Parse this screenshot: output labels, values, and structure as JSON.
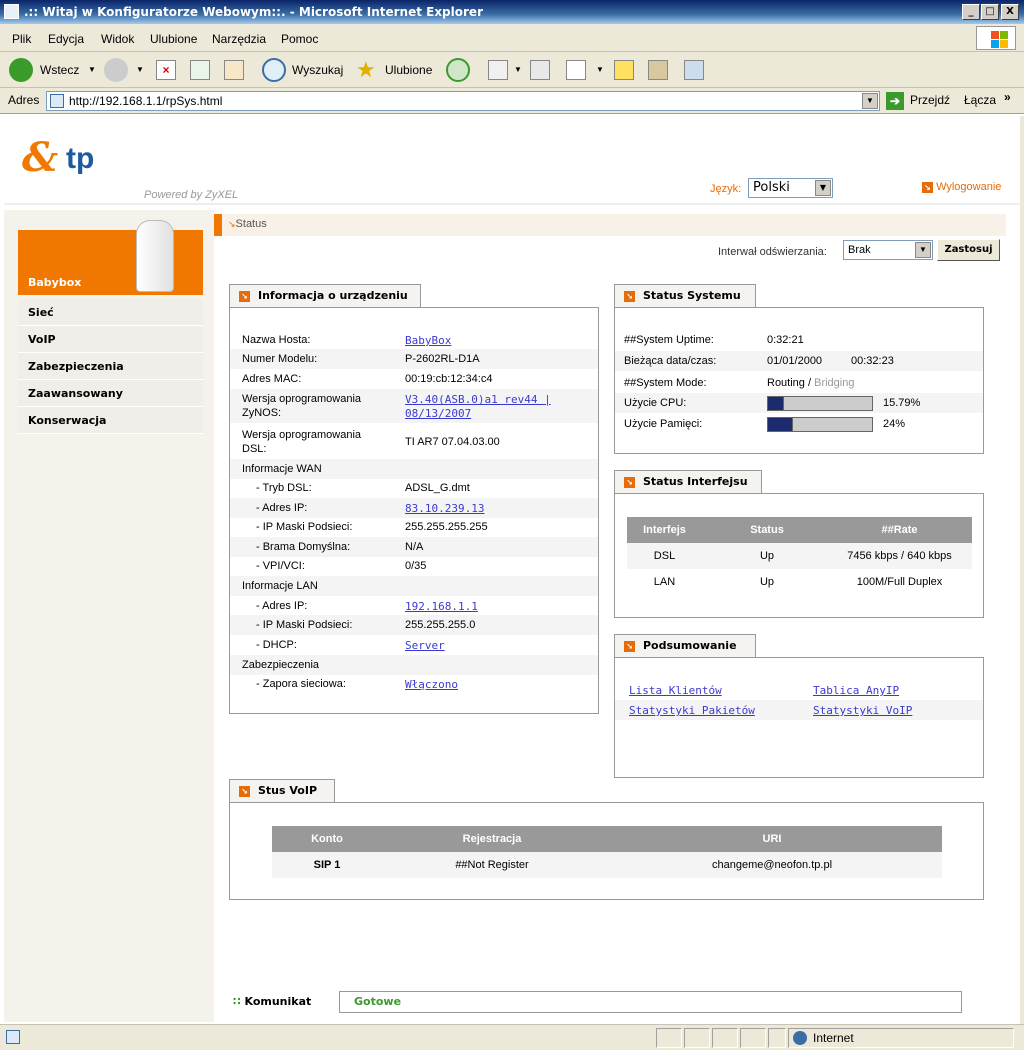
{
  "window": {
    "title": ".:: Witaj w Konfiguratorze Webowym::. - Microsoft Internet Explorer",
    "minimize": "_",
    "maximize": "□",
    "close": "X"
  },
  "menu": {
    "items": [
      "Plik",
      "Edycja",
      "Widok",
      "Ulubione",
      "Narzędzia",
      "Pomoc"
    ]
  },
  "toolbar": {
    "back": "Wstecz",
    "search": "Wyszukaj",
    "favorites": "Ulubione"
  },
  "address": {
    "label": "Adres",
    "url": "http://192.168.1.1/rpSys.html",
    "go": "Przejdź",
    "links": "Łącza",
    "more": "»"
  },
  "header": {
    "logo_amp": "&",
    "logo_tp": "tp",
    "powered": "Powered by ZyXEL",
    "language_label": "Język:",
    "language_value": "Polski",
    "logout": "Wylogowanie"
  },
  "sidebar": {
    "title": "Babybox",
    "items": [
      {
        "label": "Sieć"
      },
      {
        "label": "VoIP"
      },
      {
        "label": "Zabezpieczenia"
      },
      {
        "label": "Zaawansowany"
      },
      {
        "label": "Konserwacja"
      }
    ]
  },
  "breadcrumb": "Status",
  "refresh": {
    "label": "Interwał odświerzania:",
    "value": "Brak",
    "apply": "Zastosuj"
  },
  "device_info": {
    "title": "Informacja o urządzeniu",
    "host_label": "Nazwa Hosta:",
    "host_value": "BabyBox",
    "model_label": "Numer Modelu:",
    "model_value": "P-2602RL-D1A",
    "mac_label": "Adres MAC:",
    "mac_value": "00:19:cb:12:34:c4",
    "zynos_label1": "Wersja oprogramowania",
    "zynos_label2": "ZyNOS:",
    "zynos_value1": "V3.40(ASB.0)a1 rev44 |",
    "zynos_value2": "08/13/2007",
    "dsl_label1": "Wersja oprogramowania",
    "dsl_label2": "DSL:",
    "dsl_value": "TI AR7 07.04.03.00",
    "wan_header": "Informacje WAN",
    "wan_mode_label": "- Tryb DSL:",
    "wan_mode_value": "ADSL_G.dmt",
    "wan_ip_label": "- Adres IP:",
    "wan_ip_value": "83.10.239.13",
    "wan_mask_label": "- IP Maski Podsieci:",
    "wan_mask_value": "255.255.255.255",
    "wan_gw_label": "- Brama Domyślna:",
    "wan_gw_value": "N/A",
    "wan_vpi_label": "- VPI/VCI:",
    "wan_vpi_value": "0/35",
    "lan_header": "Informacje LAN",
    "lan_ip_label": "- Adres IP:",
    "lan_ip_value": "192.168.1.1",
    "lan_mask_label": "- IP Maski Podsieci:",
    "lan_mask_value": "255.255.255.0",
    "lan_dhcp_label": "- DHCP:",
    "lan_dhcp_value": "Server",
    "sec_header": "Zabezpieczenia",
    "fw_label": "- Zapora sieciowa:",
    "fw_value": "Włączono"
  },
  "system_status": {
    "title": "Status Systemu",
    "uptime_label": "##System Uptime:",
    "uptime_value": "0:32:21",
    "datetime_label": "Bieżąca data/czas:",
    "date_value": "01/01/2000",
    "time_value": "00:32:23",
    "mode_label": "##System Mode:",
    "mode_active": "Routing",
    "mode_sep": "/",
    "mode_inactive": "Bridging",
    "cpu_label": "Użycie CPU:",
    "cpu_value": "15.79%",
    "cpu_fraction": 0.1579,
    "mem_label": "Użycie Pamięci:",
    "mem_value": "24%",
    "mem_fraction": 0.24
  },
  "interface_status": {
    "title": "Status Interfejsu",
    "headers": [
      "Interfejs",
      "Status",
      "##Rate"
    ],
    "rows": [
      [
        "DSL",
        "Up",
        "7456 kbps / 640 kbps"
      ],
      [
        "LAN",
        "Up",
        "100M/Full Duplex"
      ]
    ]
  },
  "summary": {
    "title": "Podsumowanie",
    "links": [
      "Lista Klientów",
      "Tablica AnyIP",
      "Statystyki Pakietów",
      "Statystyki VoIP"
    ]
  },
  "voip_status": {
    "title": "Stus VoIP",
    "headers": [
      "Konto",
      "Rejestracja",
      "URI"
    ],
    "rows": [
      [
        "SIP 1",
        "##Not Register",
        "changeme@neofon.tp.pl"
      ]
    ]
  },
  "footer": {
    "message_label": "Komunikat",
    "message_value": "Gotowe"
  },
  "statusbar": {
    "zone": "Internet"
  },
  "colors": {
    "accent": "#f07800",
    "link": "#3a3ad0",
    "ok": "#3a9a2a"
  }
}
